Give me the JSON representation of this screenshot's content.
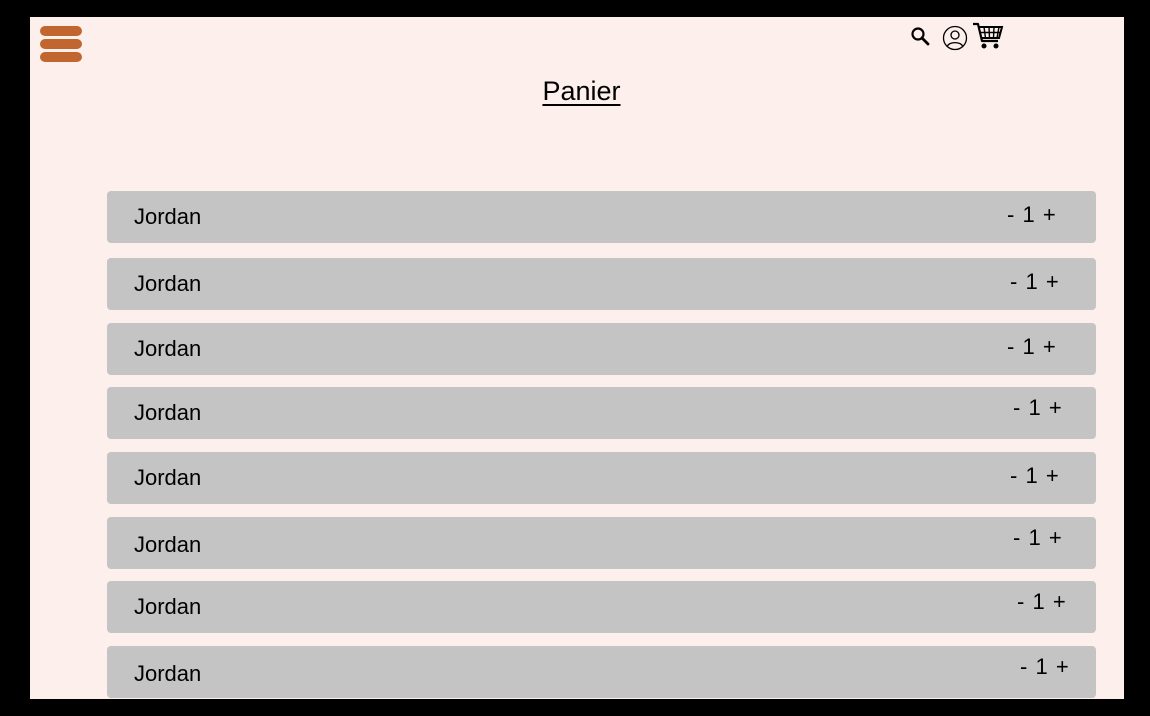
{
  "header": {
    "title": "Panier",
    "icons": {
      "menu": "hamburger-menu-icon",
      "search": "search-icon",
      "account": "user-icon",
      "cart": "cart-icon"
    }
  },
  "colors": {
    "page_background": "#fdf0ec",
    "menu_accent": "#c0662e",
    "row_background": "#c4c4c4"
  },
  "cart": {
    "items": [
      {
        "name": "Jordan",
        "minus": "-",
        "quantity": "1",
        "plus": "+"
      },
      {
        "name": "Jordan",
        "minus": "-",
        "quantity": "1",
        "plus": "+"
      },
      {
        "name": "Jordan",
        "minus": "-",
        "quantity": "1",
        "plus": "+"
      },
      {
        "name": "Jordan",
        "minus": "-",
        "quantity": "1",
        "plus": "+"
      },
      {
        "name": "Jordan",
        "minus": "-",
        "quantity": "1",
        "plus": "+"
      },
      {
        "name": "Jordan",
        "minus": "-",
        "quantity": "1",
        "plus": "+"
      },
      {
        "name": "Jordan",
        "minus": "-",
        "quantity": "1",
        "plus": "+"
      },
      {
        "name": "Jordan",
        "minus": "-",
        "quantity": "1",
        "plus": "+"
      }
    ]
  }
}
